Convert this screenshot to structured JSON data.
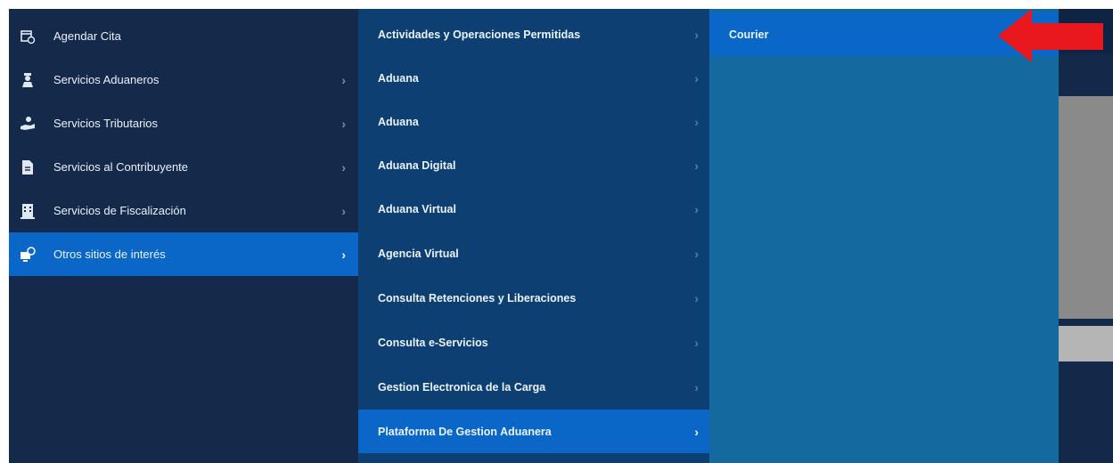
{
  "menu1": {
    "items": [
      {
        "label": "Agendar Cita",
        "icon": "calendar-icon",
        "has_submenu": false,
        "active": false
      },
      {
        "label": "Servicios Aduaneros",
        "icon": "customs-officer-icon",
        "has_submenu": true,
        "active": false
      },
      {
        "label": "Servicios Tributarios",
        "icon": "hand-coin-icon",
        "has_submenu": true,
        "active": false
      },
      {
        "label": "Servicios al Contribuyente",
        "icon": "document-icon",
        "has_submenu": true,
        "active": false
      },
      {
        "label": "Servicios de Fiscalización",
        "icon": "building-icon",
        "has_submenu": true,
        "active": false
      },
      {
        "label": "Otros sitios de interés",
        "icon": "globe-monitor-icon",
        "has_submenu": true,
        "active": true
      }
    ]
  },
  "menu2": {
    "items": [
      {
        "label": "Actividades y Operaciones Permitidas",
        "active": false
      },
      {
        "label": "Aduana",
        "active": false
      },
      {
        "label": "Aduana",
        "active": false
      },
      {
        "label": "Aduana Digital",
        "active": false
      },
      {
        "label": "Aduana Virtual",
        "active": false
      },
      {
        "label": "Agencia Virtual",
        "active": false
      },
      {
        "label": "Consulta Retenciones y Liberaciones",
        "active": false
      },
      {
        "label": "Consulta e-Servicios",
        "active": false
      },
      {
        "label": "Gestion Electronica de la Carga",
        "active": false
      },
      {
        "label": "Plataforma De Gestion Aduanera",
        "active": true
      }
    ]
  },
  "menu3": {
    "items": [
      {
        "label": "Courier",
        "active": true
      }
    ]
  },
  "annotation": {
    "icon": "red-arrow-icon",
    "color": "#e8181e"
  },
  "colors": {
    "menu1_bg": "#15294a",
    "menu2_bg": "#0d3f73",
    "menu3_bg": "#146a9f",
    "active": "#0b67c7"
  }
}
